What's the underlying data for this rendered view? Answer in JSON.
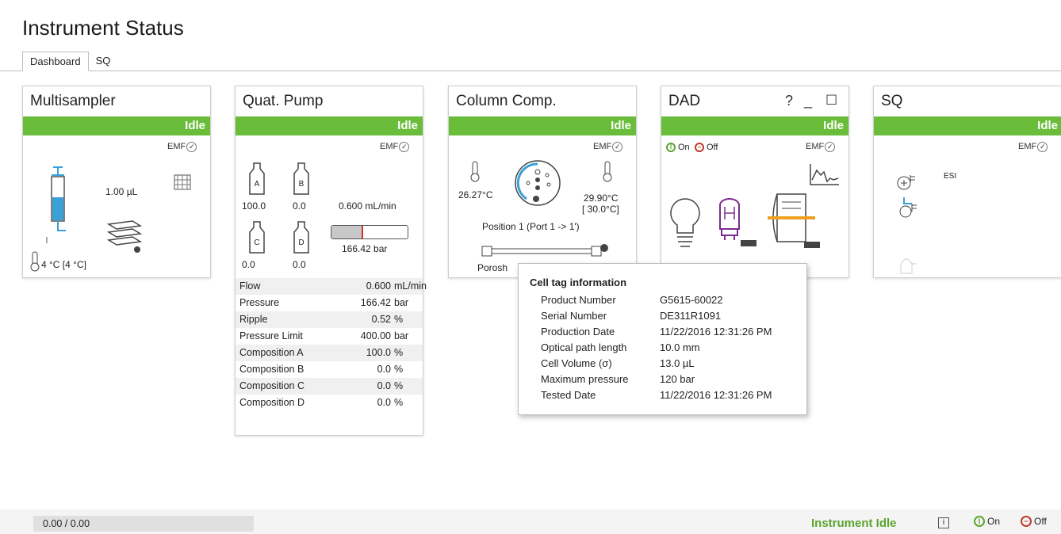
{
  "title": "Instrument Status",
  "tabs": [
    {
      "label": "Dashboard"
    },
    {
      "label": "SQ"
    }
  ],
  "colors": {
    "idle_green": "#6abd3a",
    "status_text": "#5aa52e",
    "off_red": "#c0392b"
  },
  "emf_label": "EMF",
  "multisampler": {
    "title": "Multisampler",
    "status": "Idle",
    "volume": "1.00 µL",
    "temperature": "4 °C [4 °C]"
  },
  "quat_pump": {
    "title": "Quat. Pump",
    "status": "Idle",
    "bottles": [
      {
        "label": "A",
        "value": "100.0"
      },
      {
        "label": "B",
        "value": "0.0"
      },
      {
        "label": "C",
        "value": "0.0"
      },
      {
        "label": "D",
        "value": "0.0"
      }
    ],
    "flow_display": "0.600 mL/min",
    "pressure_display": "166.42 bar",
    "pressure_fraction": 0.42,
    "table": [
      {
        "key": "Flow",
        "value": "0.600",
        "unit": "mL/min"
      },
      {
        "key": "Pressure",
        "value": "166.42",
        "unit": "bar"
      },
      {
        "key": "Ripple",
        "value": "0.52",
        "unit": "%"
      },
      {
        "key": "Pressure Limit",
        "value": "400.00",
        "unit": "bar"
      },
      {
        "key": "Composition A",
        "value": "100.0",
        "unit": "%"
      },
      {
        "key": "Composition B",
        "value": "0.0",
        "unit": "%"
      },
      {
        "key": "Composition C",
        "value": "0.0",
        "unit": "%"
      },
      {
        "key": "Composition D",
        "value": "0.0",
        "unit": "%"
      }
    ]
  },
  "column_comp": {
    "title": "Column Comp.",
    "status": "Idle",
    "temp_left": "26.27°C",
    "temp_right": "29.90°C",
    "temp_right_set": "[  30.0°C]",
    "position": "Position 1 (Port 1 -> 1')",
    "column_name": "Porosh"
  },
  "dad": {
    "title": "DAD",
    "status": "Idle",
    "help": "?",
    "minimize": "_",
    "maximize": "☐",
    "on_label": "On",
    "off_label": "Off"
  },
  "sq": {
    "title": "SQ",
    "status": "Idle",
    "source": "ESI"
  },
  "tooltip": {
    "title": "Cell tag information",
    "rows": [
      {
        "key": "Product Number",
        "value": "G5615-60022"
      },
      {
        "key": "Serial Number",
        "value": "DE311R1091"
      },
      {
        "key": "Production Date",
        "value": "11/22/2016 12:31:26 PM"
      },
      {
        "key": "Optical path length",
        "value": "10.0 mm"
      },
      {
        "key": "Cell Volume (σ)",
        "value": "13.0 µL"
      },
      {
        "key": "Maximum pressure",
        "value": "120 bar"
      },
      {
        "key": "Tested Date",
        "value": "11/22/2016 12:31:26 PM"
      }
    ]
  },
  "footer": {
    "progress": "0.00 / 0.00",
    "status": "Instrument Idle",
    "info": "i",
    "on_label": "On",
    "off_label": "Off"
  }
}
